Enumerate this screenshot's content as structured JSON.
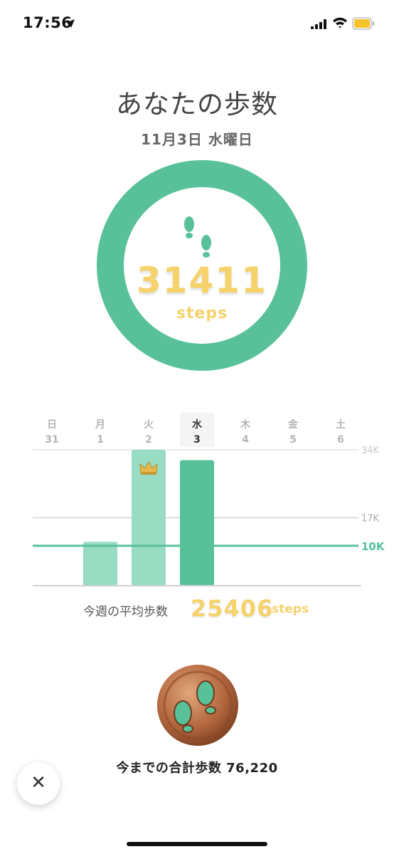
{
  "status_bar": {
    "time": "17:56"
  },
  "header": {
    "title": "あなたの歩数",
    "date": "11月3日 水曜日"
  },
  "today": {
    "steps": "31411",
    "unit": "steps"
  },
  "week": {
    "days": [
      {
        "dow": "日",
        "dom": "31"
      },
      {
        "dow": "月",
        "dom": "1"
      },
      {
        "dow": "火",
        "dom": "2"
      },
      {
        "dow": "水",
        "dom": "3"
      },
      {
        "dow": "木",
        "dom": "4"
      },
      {
        "dow": "金",
        "dom": "5"
      },
      {
        "dow": "土",
        "dom": "6"
      }
    ],
    "gridlines": [
      "34K",
      "17K"
    ],
    "goal_label": "10K",
    "average_label": "今週の平均歩数",
    "average_value": "25406",
    "average_unit": "steps"
  },
  "chart_data": {
    "type": "bar",
    "categories": [
      "31",
      "1",
      "2",
      "3",
      "4",
      "5",
      "6"
    ],
    "values": [
      0,
      11000,
      34000,
      31411,
      0,
      0,
      0
    ],
    "ylim": [
      0,
      34000
    ],
    "goal": 10000,
    "best_day": "2",
    "selected_day": "3"
  },
  "total": {
    "label": "今までの合計歩数",
    "value": "76,220"
  },
  "colors": {
    "accent": "#58c19a",
    "accent_light": "#97dcc3",
    "yellow": "#f6d26b",
    "bronze": "#b5683f"
  },
  "icons": {
    "footprints": "footprints-icon",
    "crown": "crown-icon",
    "close": "close-icon"
  }
}
